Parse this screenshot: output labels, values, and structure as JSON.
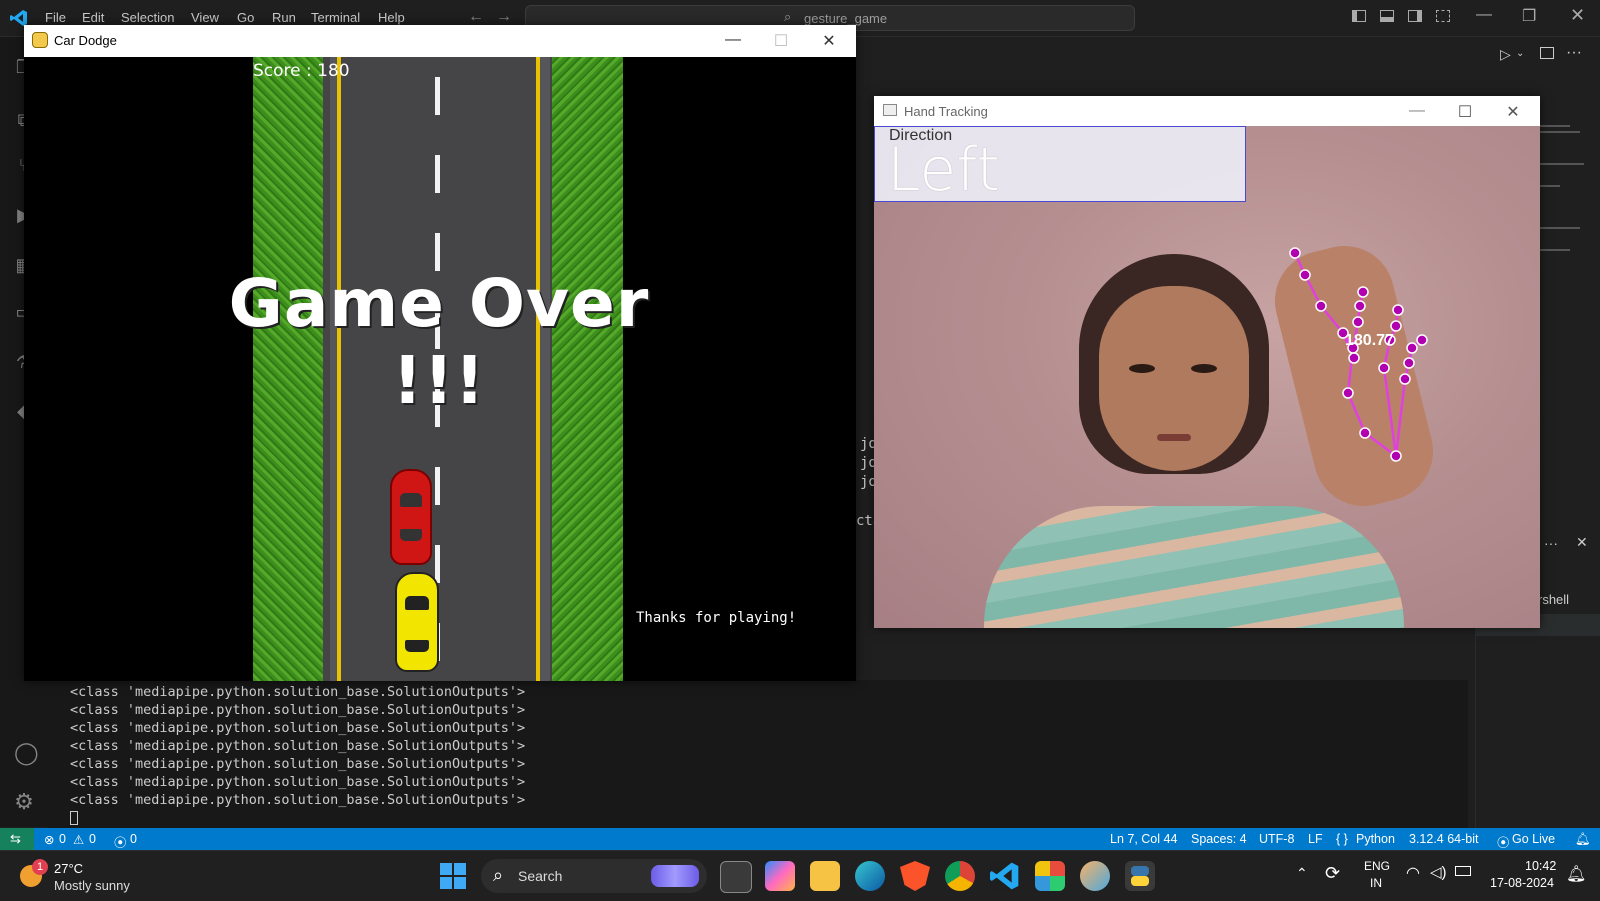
{
  "vscode": {
    "menu": [
      "File",
      "Edit",
      "Selection",
      "View",
      "Go",
      "Run",
      "Terminal",
      "Help"
    ],
    "search_text": "gesture_game",
    "terminal_lines": [
      "<class 'mediapipe.python.solution_base.SolutionOutputs'>",
      "<class 'mediapipe.python.solution_base.SolutionOutputs'>",
      "<class 'mediapipe.python.solution_base.SolutionOutputs'>",
      "<class 'mediapipe.python.solution_base.SolutionOutputs'>",
      "<class 'mediapipe.python.solution_base.SolutionOutputs'>",
      "<class 'mediapipe.python.solution_base.SolutionOutputs'>",
      "<class 'mediapipe.python.solution_base.SolutionOutputs'>"
    ],
    "bg_fragments": [
      "jo",
      "jo",
      "jo",
      "cta"
    ],
    "panel_tab": "rshell",
    "status": {
      "errors": "0",
      "warnings": "0",
      "ports": "0",
      "position": "Ln 7, Col 44",
      "spaces": "Spaces: 4",
      "encoding": "UTF-8",
      "eol": "LF",
      "language": "Python",
      "interpreter": "3.12.4 64-bit",
      "golive": "Go Live"
    }
  },
  "car_window": {
    "title": "Car Dodge",
    "score": "Score : 180",
    "game_over": "Game Over !!!",
    "thanks": "Thanks for playing!"
  },
  "hand_window": {
    "title": "Hand Tracking",
    "direction_label": "Direction",
    "direction_value": "Left",
    "angle": "180.77"
  },
  "taskbar": {
    "weather_temp": "27°C",
    "weather_desc": "Mostly sunny",
    "weather_badge": "1",
    "search": "Search",
    "lang_top": "ENG",
    "lang_bottom": "IN",
    "time": "10:42",
    "date": "17-08-2024"
  },
  "colors": {
    "statusbar": "#007acc",
    "grass": "#3e8e1e",
    "road": "#454545",
    "lane_yellow": "#e6c200",
    "car_red": "#d01515",
    "car_yellow": "#f2e600",
    "landmark": "#e040e0",
    "direction_box": "#4a4ad0"
  }
}
